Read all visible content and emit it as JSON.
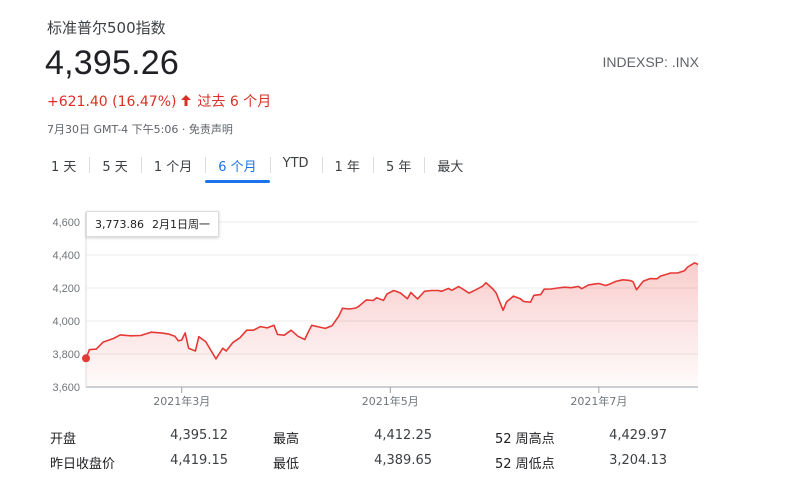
{
  "header": {
    "title": "标准普尔500指数",
    "price": "4,395.26",
    "ticker": "INDEXSP: .INX",
    "change": "+621.40 (16.47%)",
    "change_period": "过去 6 个月",
    "timestamp": "7月30日 GMT-4 下午5:06 · 免责声明"
  },
  "tabs": [
    {
      "label": "1 天"
    },
    {
      "label": "5 天"
    },
    {
      "label": "1 个月"
    },
    {
      "label": "6 个月"
    },
    {
      "label": "YTD"
    },
    {
      "label": "1 年"
    },
    {
      "label": "5 年"
    },
    {
      "label": "最大"
    }
  ],
  "active_tab": "6 个月",
  "tooltip": {
    "value": "3,773.86",
    "date": "2月1日周一"
  },
  "stats": [
    {
      "label": "开盘",
      "value": "4,395.12"
    },
    {
      "label": "最高",
      "value": "4,412.25"
    },
    {
      "label": "52 周高点",
      "value": "4,429.97"
    },
    {
      "label": "昨日收盘价",
      "value": "4,419.15"
    },
    {
      "label": "最低",
      "value": "4,389.65"
    },
    {
      "label": "52 周低点",
      "value": "3,204.13"
    }
  ],
  "colors": {
    "line": "#e53935",
    "up": "#d93025",
    "accent": "#1a73e8"
  },
  "chart_data": {
    "type": "area",
    "x_ticks": [
      "2021年3月",
      "2021年5月",
      "2021年7月"
    ],
    "y_ticks": [
      "4,600",
      "4,400",
      "4,200",
      "4,000",
      "3,800",
      "3,600"
    ],
    "ylim": [
      3600,
      4600
    ],
    "x_range": [
      "2021-02-01",
      "2021-07-30"
    ],
    "series": [
      {
        "values": [
          {
            "x": "2021-02-01",
            "y": 3774
          },
          {
            "x": "2021-02-02",
            "y": 3826
          },
          {
            "x": "2021-02-04",
            "y": 3830
          },
          {
            "x": "2021-02-06",
            "y": 3872
          },
          {
            "x": "2021-02-09",
            "y": 3894
          },
          {
            "x": "2021-02-11",
            "y": 3916
          },
          {
            "x": "2021-02-14",
            "y": 3910
          },
          {
            "x": "2021-02-17",
            "y": 3912
          },
          {
            "x": "2021-02-20",
            "y": 3932
          },
          {
            "x": "2021-02-23",
            "y": 3928
          },
          {
            "x": "2021-02-25",
            "y": 3922
          },
          {
            "x": "2021-02-27",
            "y": 3908
          },
          {
            "x": "2021-02-28",
            "y": 3880
          },
          {
            "x": "2021-03-01",
            "y": 3885
          },
          {
            "x": "2021-03-02",
            "y": 3928
          },
          {
            "x": "2021-03-03",
            "y": 3835
          },
          {
            "x": "2021-03-05",
            "y": 3818
          },
          {
            "x": "2021-03-06",
            "y": 3905
          },
          {
            "x": "2021-03-08",
            "y": 3875
          },
          {
            "x": "2021-03-11",
            "y": 3770
          },
          {
            "x": "2021-03-13",
            "y": 3835
          },
          {
            "x": "2021-03-14",
            "y": 3818
          },
          {
            "x": "2021-03-16",
            "y": 3870
          },
          {
            "x": "2021-03-18",
            "y": 3898
          },
          {
            "x": "2021-03-20",
            "y": 3944
          },
          {
            "x": "2021-03-22",
            "y": 3944
          },
          {
            "x": "2021-03-24",
            "y": 3966
          },
          {
            "x": "2021-03-26",
            "y": 3958
          },
          {
            "x": "2021-03-28",
            "y": 3974
          },
          {
            "x": "2021-03-29",
            "y": 3918
          },
          {
            "x": "2021-03-31",
            "y": 3914
          },
          {
            "x": "2021-04-02",
            "y": 3944
          },
          {
            "x": "2021-04-04",
            "y": 3907
          },
          {
            "x": "2021-04-06",
            "y": 3888
          },
          {
            "x": "2021-04-07",
            "y": 3932
          },
          {
            "x": "2021-04-08",
            "y": 3974
          },
          {
            "x": "2021-04-10",
            "y": 3964
          },
          {
            "x": "2021-04-12",
            "y": 3955
          },
          {
            "x": "2021-04-14",
            "y": 3972
          },
          {
            "x": "2021-04-16",
            "y": 4032
          },
          {
            "x": "2021-04-17",
            "y": 4077
          },
          {
            "x": "2021-04-19",
            "y": 4073
          },
          {
            "x": "2021-04-21",
            "y": 4079
          },
          {
            "x": "2021-04-22",
            "y": 4093
          },
          {
            "x": "2021-04-24",
            "y": 4128
          },
          {
            "x": "2021-04-26",
            "y": 4124
          },
          {
            "x": "2021-04-27",
            "y": 4141
          },
          {
            "x": "2021-04-29",
            "y": 4125
          },
          {
            "x": "2021-04-30",
            "y": 4163
          },
          {
            "x": "2021-05-02",
            "y": 4185
          },
          {
            "x": "2021-05-04",
            "y": 4170
          },
          {
            "x": "2021-05-06",
            "y": 4135
          },
          {
            "x": "2021-05-07",
            "y": 4173
          },
          {
            "x": "2021-05-09",
            "y": 4134
          },
          {
            "x": "2021-05-11",
            "y": 4180
          },
          {
            "x": "2021-05-13",
            "y": 4185
          },
          {
            "x": "2021-05-15",
            "y": 4185
          },
          {
            "x": "2021-05-16",
            "y": 4180
          },
          {
            "x": "2021-05-18",
            "y": 4197
          },
          {
            "x": "2021-05-19",
            "y": 4186
          },
          {
            "x": "2021-05-21",
            "y": 4209
          },
          {
            "x": "2021-05-23",
            "y": 4183
          },
          {
            "x": "2021-05-24",
            "y": 4169
          },
          {
            "x": "2021-05-26",
            "y": 4189
          },
          {
            "x": "2021-05-28",
            "y": 4211
          },
          {
            "x": "2021-05-29",
            "y": 4232
          },
          {
            "x": "2021-05-31",
            "y": 4194
          },
          {
            "x": "2021-06-01",
            "y": 4168
          },
          {
            "x": "2021-06-03",
            "y": 4065
          },
          {
            "x": "2021-06-04",
            "y": 4115
          },
          {
            "x": "2021-06-06",
            "y": 4151
          },
          {
            "x": "2021-06-08",
            "y": 4136
          },
          {
            "x": "2021-06-09",
            "y": 4118
          },
          {
            "x": "2021-06-11",
            "y": 4114
          },
          {
            "x": "2021-06-12",
            "y": 4156
          },
          {
            "x": "2021-06-14",
            "y": 4160
          },
          {
            "x": "2021-06-15",
            "y": 4193
          },
          {
            "x": "2021-06-17",
            "y": 4194
          },
          {
            "x": "2021-06-19",
            "y": 4200
          },
          {
            "x": "2021-06-21",
            "y": 4205
          },
          {
            "x": "2021-06-23",
            "y": 4202
          },
          {
            "x": "2021-06-25",
            "y": 4210
          },
          {
            "x": "2021-06-26",
            "y": 4196
          },
          {
            "x": "2021-06-28",
            "y": 4219
          },
          {
            "x": "2021-06-30",
            "y": 4225
          },
          {
            "x": "2021-07-01",
            "y": 4227
          },
          {
            "x": "2021-07-03",
            "y": 4215
          },
          {
            "x": "2021-07-04",
            "y": 4222
          },
          {
            "x": "2021-07-06",
            "y": 4240
          },
          {
            "x": "2021-07-08",
            "y": 4250
          },
          {
            "x": "2021-07-10",
            "y": 4246
          },
          {
            "x": "2021-07-11",
            "y": 4239
          },
          {
            "x": "2021-07-12",
            "y": 4190
          },
          {
            "x": "2021-07-14",
            "y": 4242
          },
          {
            "x": "2021-07-16",
            "y": 4257
          },
          {
            "x": "2021-07-18",
            "y": 4256
          },
          {
            "x": "2021-07-19",
            "y": 4272
          },
          {
            "x": "2021-07-21",
            "y": 4284
          },
          {
            "x": "2021-07-22",
            "y": 4291
          },
          {
            "x": "2021-07-24",
            "y": 4291
          },
          {
            "x": "2021-07-26",
            "y": 4304
          },
          {
            "x": "2021-07-27",
            "y": 4327
          },
          {
            "x": "2021-07-29",
            "y": 4353
          },
          {
            "x": "2021-07-30",
            "y": 4343
          }
        ]
      }
    ],
    "grid": true
  }
}
